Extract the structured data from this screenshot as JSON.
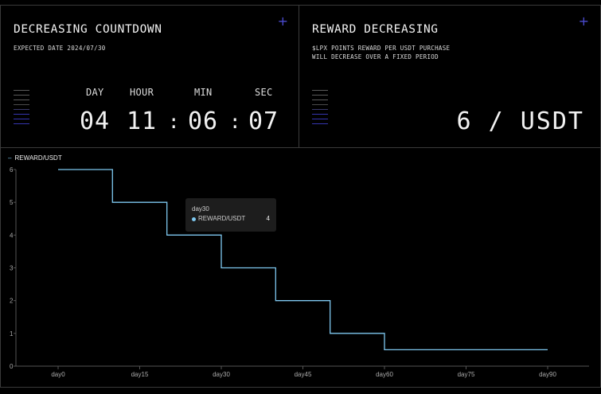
{
  "countdown": {
    "title": "DECREASING COUNTDOWN",
    "subtitle": "EXPECTED DATE 2024/07/30",
    "labels": [
      "DAY",
      "HOUR",
      "MIN",
      "SEC"
    ],
    "values": [
      "04",
      "11",
      "06",
      "07"
    ],
    "separator": ":",
    "plus": "+"
  },
  "reward": {
    "title": "REWARD DECREASING",
    "subtitle": "$LPX POINTS REWARD PER USDT PURCHASE\nWILL DECREASE OVER A FIXED PERIOD",
    "value": "6 / USDT",
    "plus": "+"
  },
  "colors": {
    "accent": "#7ec8f0",
    "plus": "#4b4bd1",
    "bar_light": "#5a5a5a",
    "bar_accent": "#3535b0"
  },
  "tooltip": {
    "x": "day30",
    "series": "REWARD/USDT",
    "value": "4"
  },
  "chart_data": {
    "type": "line",
    "step": true,
    "series": [
      {
        "name": "REWARD/USDT",
        "x": [
          0,
          10,
          10,
          20,
          20,
          30,
          30,
          40,
          40,
          50,
          50,
          60,
          60,
          70,
          70,
          80,
          80,
          90
        ],
        "values": [
          6,
          6,
          5,
          5,
          4,
          4,
          3,
          3,
          2,
          2,
          1,
          1,
          0.5,
          0.5,
          0.5,
          0.5,
          0.5,
          0.5
        ]
      }
    ],
    "x_ticks": [
      "day0",
      "day15",
      "day30",
      "day45",
      "day60",
      "day75",
      "day90"
    ],
    "x_tick_values": [
      0,
      15,
      30,
      45,
      60,
      75,
      90
    ],
    "y_ticks": [
      "0",
      "1",
      "2",
      "3",
      "4",
      "5",
      "6"
    ],
    "xlim": [
      0,
      90
    ],
    "ylim": [
      0,
      6
    ],
    "grid": false,
    "legend": "top-left"
  }
}
